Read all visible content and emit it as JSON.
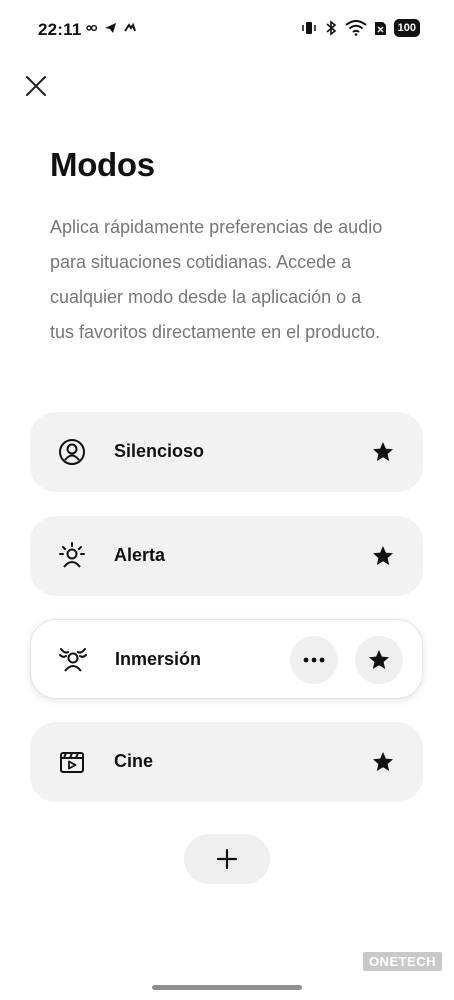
{
  "status_bar": {
    "time": "22:11",
    "battery": "100"
  },
  "header": {
    "title": "Modos",
    "description": "Aplica rápidamente preferencias de audio para situaciones cotidianas. Accede a cualquier modo desde la aplicación o a tus favoritos directamente en el producto."
  },
  "modes": [
    {
      "label": "Silencioso",
      "icon": "person-circle-icon",
      "favorite": true
    },
    {
      "label": "Alerta",
      "icon": "person-alert-icon",
      "favorite": true
    },
    {
      "label": "Inmersión",
      "icon": "person-immersion-icon",
      "favorite": true,
      "active": true
    },
    {
      "label": "Cine",
      "icon": "clapperboard-icon",
      "favorite": true
    }
  ],
  "watermark": "ONETECH"
}
